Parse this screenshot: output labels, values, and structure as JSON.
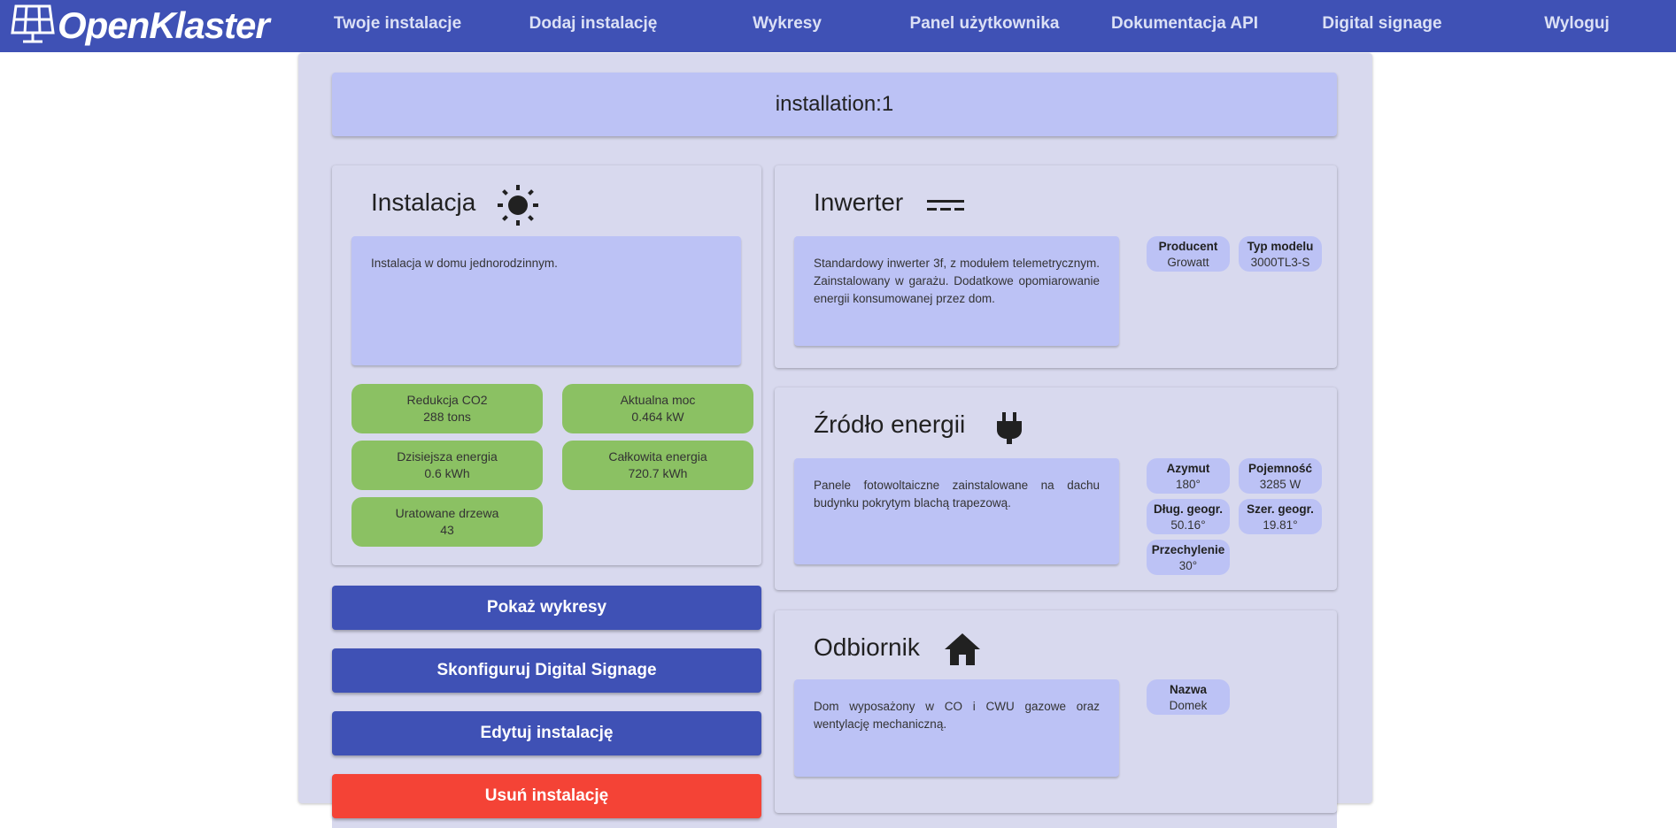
{
  "navbar": {
    "brand": "OpenKlaster",
    "links": [
      "Twoje instalacje",
      "Dodaj instalację",
      "Wykresy",
      "Panel użytkownika",
      "Dokumentacja API",
      "Digital signage",
      "Wyloguj"
    ]
  },
  "page_title": "installation:1",
  "installation": {
    "title": "Instalacja",
    "icon": "sun-icon",
    "description": "Instalacja w domu jednorodzinnym.",
    "stats": [
      {
        "label": "Redukcja CO2",
        "value": "288 tons"
      },
      {
        "label": "Aktualna moc",
        "value": "0.464 kW"
      },
      {
        "label": "Dzisiejsza energia",
        "value": "0.6 kWh"
      },
      {
        "label": "Całkowita energia",
        "value": "720.7 kWh"
      },
      {
        "label": "Uratowane drzewa",
        "value": "43"
      }
    ]
  },
  "actions": {
    "show_charts": "Pokaż wykresy",
    "configure_signage": "Skonfiguruj Digital Signage",
    "edit": "Edytuj instalację",
    "delete": "Usuń instalację"
  },
  "inverter": {
    "title": "Inwerter",
    "icon": "dc-current-icon",
    "description": "Standardowy inwerter 3f, z modułem telemetrycznym. Zainstalowany w garażu. Dodatkowe opomiarowanie energii konsumowanej przez dom.",
    "props": [
      {
        "key": "Producent",
        "value": "Growatt"
      },
      {
        "key": "Typ modelu",
        "value": "3000TL3-S"
      }
    ]
  },
  "source": {
    "title": "Źródło energii",
    "icon": "power-plug-icon",
    "description": "Panele fotowoltaiczne zainstalowane na dachu budynku pokrytym blachą trapezową.",
    "props": [
      {
        "key": "Azymut",
        "value": "180°"
      },
      {
        "key": "Pojemność",
        "value": "3285 W"
      },
      {
        "key": "Dług. geogr.",
        "value": "50.16°"
      },
      {
        "key": "Szer. geogr.",
        "value": "19.81°"
      },
      {
        "key": "Przechylenie",
        "value": "30°"
      }
    ]
  },
  "receiver": {
    "title": "Odbiornik",
    "icon": "home-icon",
    "description": "Dom wyposażony w CO i CWU gazowe oraz wentylację mechaniczną.",
    "props": [
      {
        "key": "Nazwa",
        "value": "Domek"
      }
    ]
  },
  "colors": {
    "primary": "#3f51b5",
    "panel": "#d8d9ee",
    "description_bg": "#bcc2f5",
    "stat_bg": "#8bc163",
    "danger": "#f44336"
  }
}
